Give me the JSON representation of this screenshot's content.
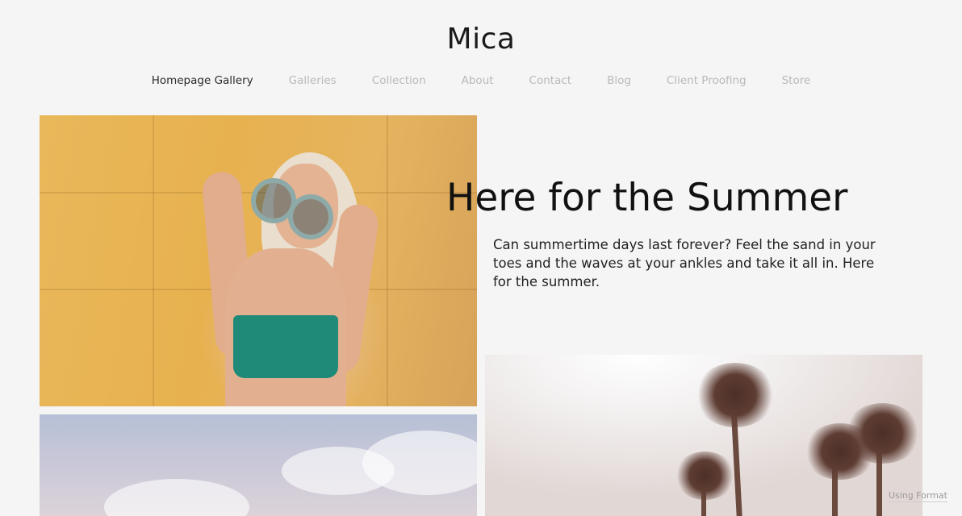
{
  "site": {
    "title": "Mica"
  },
  "nav": {
    "items": [
      {
        "label": "Homepage Gallery",
        "active": true
      },
      {
        "label": "Galleries",
        "active": false
      },
      {
        "label": "Collection",
        "active": false
      },
      {
        "label": "About",
        "active": false
      },
      {
        "label": "Contact",
        "active": false
      },
      {
        "label": "Blog",
        "active": false
      },
      {
        "label": "Client Proofing",
        "active": false
      },
      {
        "label": "Store",
        "active": false
      }
    ]
  },
  "feature": {
    "heading": "Here for the Summer",
    "body": "Can summertime days last forever? Feel the sand in your toes and the waves at your ankles and take it all in. Here for the summer."
  },
  "badge": {
    "label": "Using Format"
  },
  "colors": {
    "background": "#f5f5f5",
    "nav_active": "#2a2a2a",
    "nav_inactive": "#b9b9b9"
  }
}
